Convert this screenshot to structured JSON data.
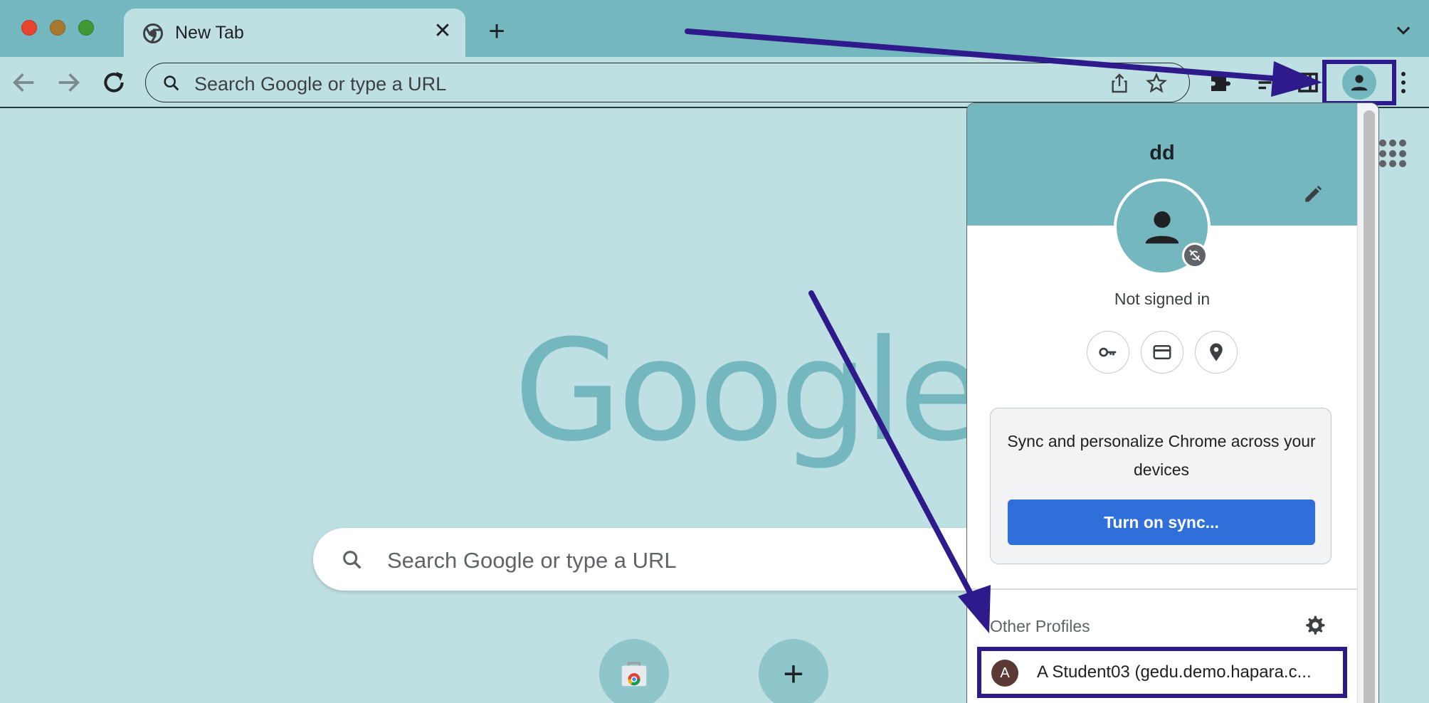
{
  "browser": {
    "tab": {
      "title": "New Tab",
      "close_glyph": "✕"
    },
    "new_tab_glyph": "+",
    "omnibox": {
      "placeholder": "Search Google or type a URL"
    }
  },
  "ntp": {
    "logo_text": "Google",
    "search_placeholder": "Search Google or type a URL",
    "add_shortcut_glyph": "+"
  },
  "profile_menu": {
    "name": "dd",
    "status": "Not signed in",
    "sync_prompt": "Sync and personalize Chrome across your devices",
    "sync_button": "Turn on sync...",
    "other_profiles_label": "Other Profiles",
    "other_profiles": [
      {
        "initial": "A",
        "label": "A Student03 (gedu.demo.hapara.c..."
      }
    ]
  },
  "icons": [
    "chrome-logo-icon",
    "close-icon",
    "plus-icon",
    "chevron-down-icon",
    "back-icon",
    "forward-icon",
    "reload-icon",
    "search-icon",
    "share-icon",
    "star-icon",
    "extensions-icon",
    "reading-list-icon",
    "side-panel-icon",
    "person-icon",
    "more-vert-icon",
    "apps-grid-icon",
    "edit-icon",
    "sync-off-icon",
    "key-icon",
    "credit-card-icon",
    "location-pin-icon",
    "gear-icon",
    "web-store-icon"
  ],
  "colors": {
    "tab_strip": "#74b7bf",
    "page_background": "#bfe0e3",
    "annotation_highlight": "#2e1a8a",
    "sync_button": "#2f6fd9"
  }
}
